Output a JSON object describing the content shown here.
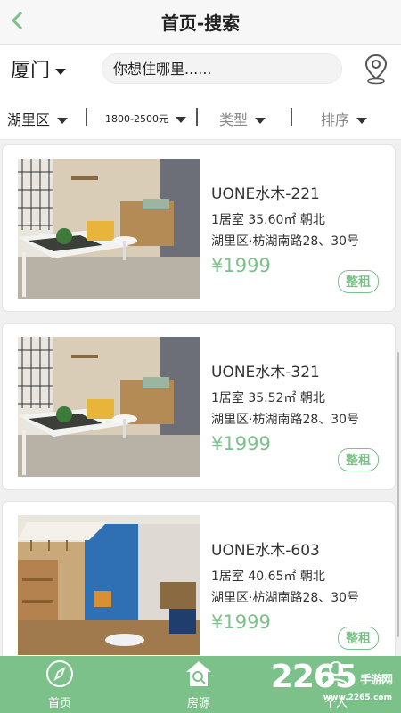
{
  "header": {
    "title": "首页-搜索",
    "back_icon": "chevron-left-icon"
  },
  "citybar": {
    "city": "厦门",
    "search_placeholder": "你想住哪里......",
    "location_icon": "map-pin-icon"
  },
  "filters": [
    {
      "label": "湖里区"
    },
    {
      "label": "1800-2500元"
    },
    {
      "label": "类型"
    },
    {
      "label": "排序"
    }
  ],
  "listings": [
    {
      "name": "UONE水木-221",
      "spec": "1居室  35.60㎡ 朝北",
      "addr": "湖里区·枋湖南路28、30号",
      "price": "¥1999",
      "tag": "整租"
    },
    {
      "name": "UONE水木-321",
      "spec": "1居室  35.52㎡ 朝北",
      "addr": "湖里区·枋湖南路28、30号",
      "price": "¥1999",
      "tag": "整租"
    },
    {
      "name": "UONE水木-603",
      "spec": "1居室  40.65㎡ 朝北",
      "addr": "湖里区·枋湖南路28、30号",
      "price": "¥1999",
      "tag": "整租"
    }
  ],
  "tabs": [
    {
      "label": "首页",
      "icon": "compass-icon"
    },
    {
      "label": "房源",
      "icon": "house-search-icon"
    },
    {
      "label": "个人",
      "icon": "person-icon"
    }
  ],
  "watermark": {
    "number": "2265",
    "suffix": "手游网",
    "domain": "www.2265.com"
  },
  "colors": {
    "accent": "#7cc08a",
    "background": "#f0f0f0"
  }
}
